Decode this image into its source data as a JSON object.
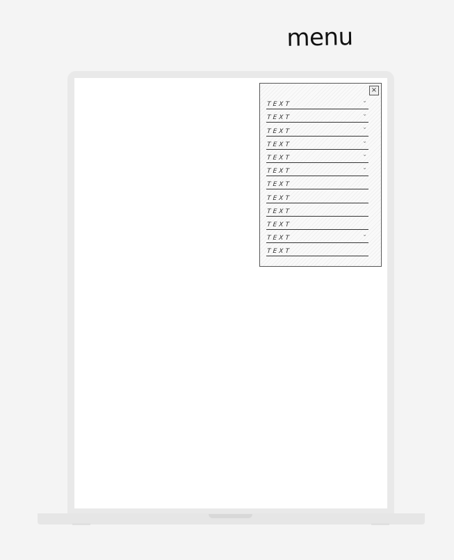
{
  "page": {
    "title": "menu"
  },
  "menu": {
    "close_label": "×",
    "items": [
      {
        "label": "TEXT",
        "has_submenu": true
      },
      {
        "label": "TEXT",
        "has_submenu": true
      },
      {
        "label": "TEXT",
        "has_submenu": true
      },
      {
        "label": "TEXT",
        "has_submenu": true
      },
      {
        "label": "TEXT",
        "has_submenu": true
      },
      {
        "label": "TEXT",
        "has_submenu": true
      },
      {
        "label": "TEXT",
        "has_submenu": false
      },
      {
        "label": "TEXT",
        "has_submenu": false
      },
      {
        "label": "TEXT",
        "has_submenu": false
      },
      {
        "label": "TEXT",
        "has_submenu": false
      },
      {
        "label": "TEXT",
        "has_submenu": true
      },
      {
        "label": "TEXT",
        "has_submenu": false
      }
    ]
  },
  "icons": {
    "chevron": "chevron-down-icon",
    "close": "close-icon"
  }
}
